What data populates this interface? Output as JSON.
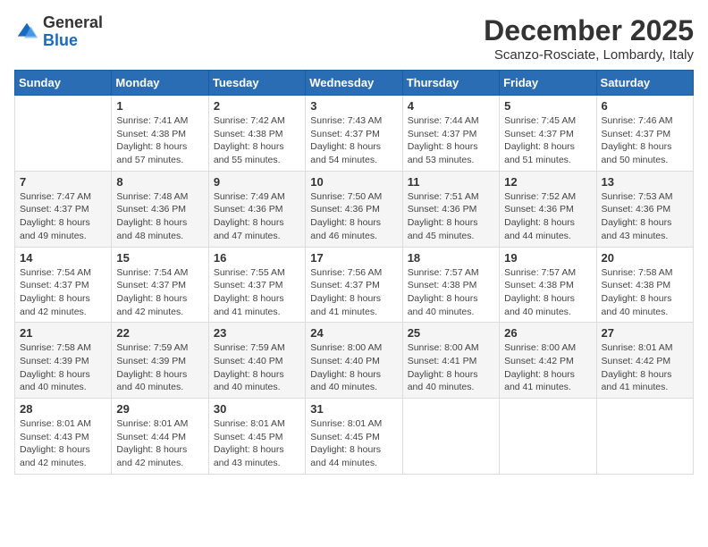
{
  "logo": {
    "general": "General",
    "blue": "Blue"
  },
  "title": "December 2025",
  "location": "Scanzo-Rosciate, Lombardy, Italy",
  "days_of_week": [
    "Sunday",
    "Monday",
    "Tuesday",
    "Wednesday",
    "Thursday",
    "Friday",
    "Saturday"
  ],
  "weeks": [
    [
      {
        "day": "",
        "info": ""
      },
      {
        "day": "1",
        "info": "Sunrise: 7:41 AM\nSunset: 4:38 PM\nDaylight: 8 hours\nand 57 minutes."
      },
      {
        "day": "2",
        "info": "Sunrise: 7:42 AM\nSunset: 4:38 PM\nDaylight: 8 hours\nand 55 minutes."
      },
      {
        "day": "3",
        "info": "Sunrise: 7:43 AM\nSunset: 4:37 PM\nDaylight: 8 hours\nand 54 minutes."
      },
      {
        "day": "4",
        "info": "Sunrise: 7:44 AM\nSunset: 4:37 PM\nDaylight: 8 hours\nand 53 minutes."
      },
      {
        "day": "5",
        "info": "Sunrise: 7:45 AM\nSunset: 4:37 PM\nDaylight: 8 hours\nand 51 minutes."
      },
      {
        "day": "6",
        "info": "Sunrise: 7:46 AM\nSunset: 4:37 PM\nDaylight: 8 hours\nand 50 minutes."
      }
    ],
    [
      {
        "day": "7",
        "info": "Sunrise: 7:47 AM\nSunset: 4:37 PM\nDaylight: 8 hours\nand 49 minutes."
      },
      {
        "day": "8",
        "info": "Sunrise: 7:48 AM\nSunset: 4:36 PM\nDaylight: 8 hours\nand 48 minutes."
      },
      {
        "day": "9",
        "info": "Sunrise: 7:49 AM\nSunset: 4:36 PM\nDaylight: 8 hours\nand 47 minutes."
      },
      {
        "day": "10",
        "info": "Sunrise: 7:50 AM\nSunset: 4:36 PM\nDaylight: 8 hours\nand 46 minutes."
      },
      {
        "day": "11",
        "info": "Sunrise: 7:51 AM\nSunset: 4:36 PM\nDaylight: 8 hours\nand 45 minutes."
      },
      {
        "day": "12",
        "info": "Sunrise: 7:52 AM\nSunset: 4:36 PM\nDaylight: 8 hours\nand 44 minutes."
      },
      {
        "day": "13",
        "info": "Sunrise: 7:53 AM\nSunset: 4:36 PM\nDaylight: 8 hours\nand 43 minutes."
      }
    ],
    [
      {
        "day": "14",
        "info": "Sunrise: 7:54 AM\nSunset: 4:37 PM\nDaylight: 8 hours\nand 42 minutes."
      },
      {
        "day": "15",
        "info": "Sunrise: 7:54 AM\nSunset: 4:37 PM\nDaylight: 8 hours\nand 42 minutes."
      },
      {
        "day": "16",
        "info": "Sunrise: 7:55 AM\nSunset: 4:37 PM\nDaylight: 8 hours\nand 41 minutes."
      },
      {
        "day": "17",
        "info": "Sunrise: 7:56 AM\nSunset: 4:37 PM\nDaylight: 8 hours\nand 41 minutes."
      },
      {
        "day": "18",
        "info": "Sunrise: 7:57 AM\nSunset: 4:38 PM\nDaylight: 8 hours\nand 40 minutes."
      },
      {
        "day": "19",
        "info": "Sunrise: 7:57 AM\nSunset: 4:38 PM\nDaylight: 8 hours\nand 40 minutes."
      },
      {
        "day": "20",
        "info": "Sunrise: 7:58 AM\nSunset: 4:38 PM\nDaylight: 8 hours\nand 40 minutes."
      }
    ],
    [
      {
        "day": "21",
        "info": "Sunrise: 7:58 AM\nSunset: 4:39 PM\nDaylight: 8 hours\nand 40 minutes."
      },
      {
        "day": "22",
        "info": "Sunrise: 7:59 AM\nSunset: 4:39 PM\nDaylight: 8 hours\nand 40 minutes."
      },
      {
        "day": "23",
        "info": "Sunrise: 7:59 AM\nSunset: 4:40 PM\nDaylight: 8 hours\nand 40 minutes."
      },
      {
        "day": "24",
        "info": "Sunrise: 8:00 AM\nSunset: 4:40 PM\nDaylight: 8 hours\nand 40 minutes."
      },
      {
        "day": "25",
        "info": "Sunrise: 8:00 AM\nSunset: 4:41 PM\nDaylight: 8 hours\nand 40 minutes."
      },
      {
        "day": "26",
        "info": "Sunrise: 8:00 AM\nSunset: 4:42 PM\nDaylight: 8 hours\nand 41 minutes."
      },
      {
        "day": "27",
        "info": "Sunrise: 8:01 AM\nSunset: 4:42 PM\nDaylight: 8 hours\nand 41 minutes."
      }
    ],
    [
      {
        "day": "28",
        "info": "Sunrise: 8:01 AM\nSunset: 4:43 PM\nDaylight: 8 hours\nand 42 minutes."
      },
      {
        "day": "29",
        "info": "Sunrise: 8:01 AM\nSunset: 4:44 PM\nDaylight: 8 hours\nand 42 minutes."
      },
      {
        "day": "30",
        "info": "Sunrise: 8:01 AM\nSunset: 4:45 PM\nDaylight: 8 hours\nand 43 minutes."
      },
      {
        "day": "31",
        "info": "Sunrise: 8:01 AM\nSunset: 4:45 PM\nDaylight: 8 hours\nand 44 minutes."
      },
      {
        "day": "",
        "info": ""
      },
      {
        "day": "",
        "info": ""
      },
      {
        "day": "",
        "info": ""
      }
    ]
  ]
}
